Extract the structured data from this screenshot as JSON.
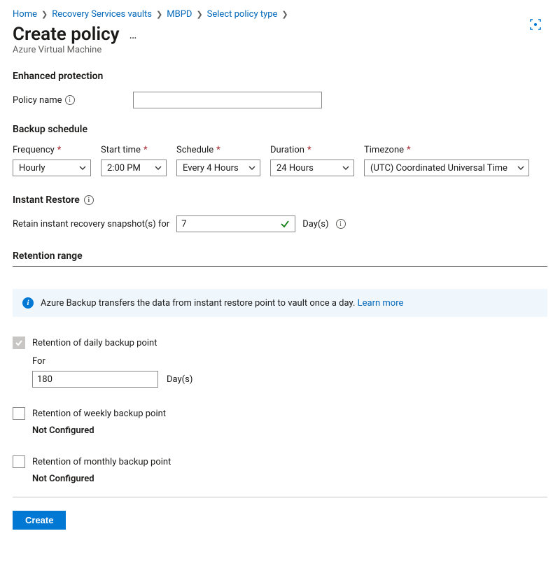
{
  "breadcrumb": {
    "items": [
      "Home",
      "Recovery Services vaults",
      "MBPD",
      "Select policy type"
    ]
  },
  "page": {
    "title": "Create policy",
    "subtitle": "Azure Virtual Machine"
  },
  "enhanced": {
    "heading": "Enhanced protection",
    "policy_name_label": "Policy name",
    "policy_name_value": ""
  },
  "schedule": {
    "heading": "Backup schedule",
    "frequency": {
      "label": "Frequency",
      "value": "Hourly"
    },
    "start_time": {
      "label": "Start time",
      "value": "2:00 PM"
    },
    "schedule": {
      "label": "Schedule",
      "value": "Every 4 Hours"
    },
    "duration": {
      "label": "Duration",
      "value": "24 Hours"
    },
    "timezone": {
      "label": "Timezone",
      "value": "(UTC) Coordinated Universal Time"
    }
  },
  "instant": {
    "heading": "Instant Restore",
    "sentence_prefix": "Retain instant recovery snapshot(s) for",
    "value": "7",
    "unit": "Day(s)"
  },
  "retention": {
    "heading": "Retention range",
    "info_text": "Azure Backup transfers the data from instant restore point to vault once a day.",
    "info_link": "Learn more",
    "daily": {
      "label": "Retention of daily backup point",
      "for_label": "For",
      "value": "180",
      "unit": "Day(s)"
    },
    "weekly": {
      "label": "Retention of weekly backup point",
      "status": "Not Configured"
    },
    "monthly": {
      "label": "Retention of monthly backup point",
      "status": "Not Configured"
    }
  },
  "footer": {
    "create": "Create"
  }
}
